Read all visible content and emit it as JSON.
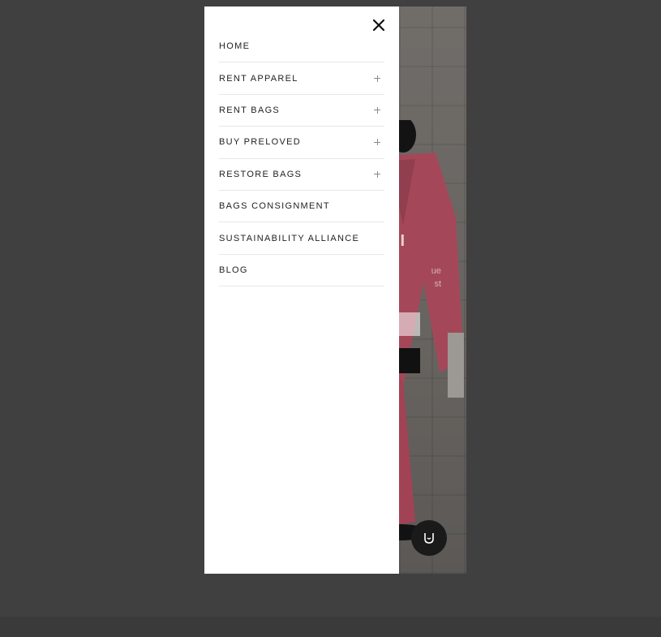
{
  "drawer": {
    "close_icon": "close-icon",
    "menu": [
      {
        "label": "HOME",
        "expandable": false
      },
      {
        "label": "RENT APPAREL",
        "expandable": true
      },
      {
        "label": "RENT BAGS",
        "expandable": true
      },
      {
        "label": "BUY PRELOVED",
        "expandable": true
      },
      {
        "label": "RESTORE BAGS",
        "expandable": true
      },
      {
        "label": "BAGS CONSIGNMENT",
        "expandable": false
      },
      {
        "label": "SUSTAINABILITY ALLIANCE",
        "expandable": false
      },
      {
        "label": "BLOG",
        "expandable": false
      }
    ]
  },
  "background_page": {
    "hero_partial_heading": "BI",
    "hero_partial_sub_1": "ue",
    "hero_partial_sub_2": "st",
    "chat_icon": "chat-icon"
  },
  "colors": {
    "backdrop": "#404040",
    "drawer": "#ffffff",
    "suit": "#e4647c",
    "divider": "#e7e7e7"
  }
}
